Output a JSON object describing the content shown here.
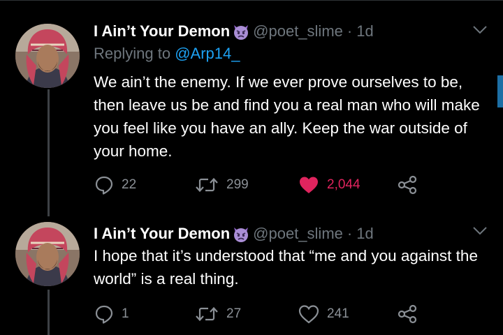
{
  "colors": {
    "background": "#000000",
    "text": "#ffffff",
    "muted": "#6e767d",
    "link": "#1da1f2",
    "like": "#e0245e",
    "divider": "#2f3336"
  },
  "tweets": [
    {
      "author_name": "I Ain’t Your Demon",
      "author_emoji": "angry-purple-devil-emoji",
      "handle": "@poet_slime",
      "time": "1d",
      "reply_prefix": "Replying to ",
      "reply_to": "@Arp14_",
      "text": "We ain’t the enemy. If we ever prove ourselves to be, then leave us be and find you a real man who will make you feel like you have an ally. Keep the war outside of your home.",
      "replies": "22",
      "retweets": "299",
      "likes": "2,044",
      "liked": true
    },
    {
      "author_name": "I Ain’t Your Demon",
      "author_emoji": "angry-purple-devil-emoji",
      "handle": "@poet_slime",
      "time": "1d",
      "text": "I hope that it’s understood that “me and you against the world” is a real thing.",
      "replies": "1",
      "retweets": "27",
      "likes": "241",
      "liked": false
    }
  ]
}
